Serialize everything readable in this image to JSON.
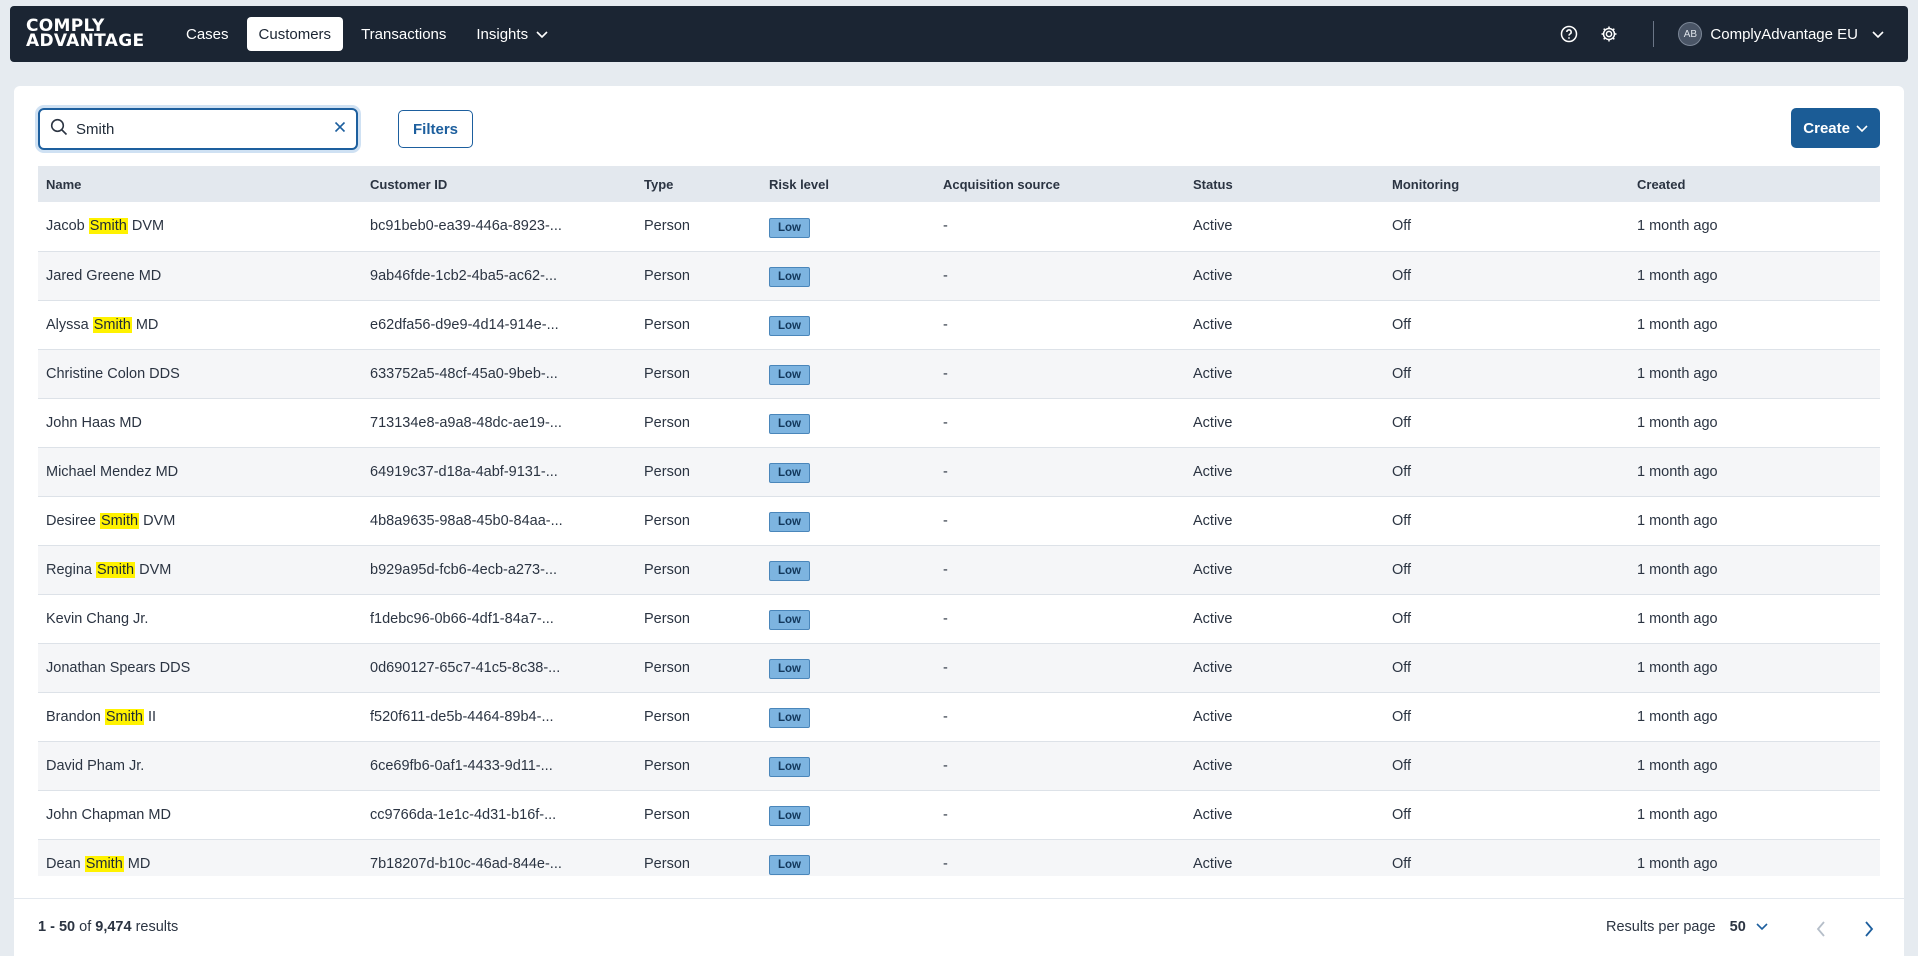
{
  "app": {
    "logo_line1": "COMPLY",
    "logo_line2": "ADVANTAGE",
    "nav": [
      {
        "label": "Cases"
      },
      {
        "label": "Customers"
      },
      {
        "label": "Transactions"
      },
      {
        "label": "Insights"
      }
    ],
    "account_initials": "AB",
    "account_name": "ComplyAdvantage EU"
  },
  "toolbar": {
    "search_value": "Smith",
    "filters_label": "Filters",
    "create_label": "Create"
  },
  "table": {
    "headers": [
      "Name",
      "Customer ID",
      "Type",
      "Risk level",
      "Acquisition source",
      "Status",
      "Monitoring",
      "Created"
    ],
    "highlight": "Smith",
    "rows": [
      {
        "name": "Jacob Smith DVM",
        "id": "bc91beb0-ea39-446a-8923-...",
        "type": "Person",
        "risk": "Low",
        "source": "-",
        "status": "Active",
        "monitoring": "Off",
        "created": "1 month ago"
      },
      {
        "name": "Jared Greene MD",
        "id": "9ab46fde-1cb2-4ba5-ac62-...",
        "type": "Person",
        "risk": "Low",
        "source": "-",
        "status": "Active",
        "monitoring": "Off",
        "created": "1 month ago"
      },
      {
        "name": "Alyssa Smith MD",
        "id": "e62dfa56-d9e9-4d14-914e-...",
        "type": "Person",
        "risk": "Low",
        "source": "-",
        "status": "Active",
        "monitoring": "Off",
        "created": "1 month ago"
      },
      {
        "name": "Christine Colon DDS",
        "id": "633752a5-48cf-45a0-9beb-...",
        "type": "Person",
        "risk": "Low",
        "source": "-",
        "status": "Active",
        "monitoring": "Off",
        "created": "1 month ago"
      },
      {
        "name": "John Haas MD",
        "id": "713134e8-a9a8-48dc-ae19-...",
        "type": "Person",
        "risk": "Low",
        "source": "-",
        "status": "Active",
        "monitoring": "Off",
        "created": "1 month ago"
      },
      {
        "name": "Michael Mendez MD",
        "id": "64919c37-d18a-4abf-9131-...",
        "type": "Person",
        "risk": "Low",
        "source": "-",
        "status": "Active",
        "monitoring": "Off",
        "created": "1 month ago"
      },
      {
        "name": "Desiree Smith DVM",
        "id": "4b8a9635-98a8-45b0-84aa-...",
        "type": "Person",
        "risk": "Low",
        "source": "-",
        "status": "Active",
        "monitoring": "Off",
        "created": "1 month ago"
      },
      {
        "name": "Regina Smith DVM",
        "id": "b929a95d-fcb6-4ecb-a273-...",
        "type": "Person",
        "risk": "Low",
        "source": "-",
        "status": "Active",
        "monitoring": "Off",
        "created": "1 month ago"
      },
      {
        "name": "Kevin Chang Jr.",
        "id": "f1debc96-0b66-4df1-84a7-...",
        "type": "Person",
        "risk": "Low",
        "source": "-",
        "status": "Active",
        "monitoring": "Off",
        "created": "1 month ago"
      },
      {
        "name": "Jonathan Spears DDS",
        "id": "0d690127-65c7-41c5-8c38-...",
        "type": "Person",
        "risk": "Low",
        "source": "-",
        "status": "Active",
        "monitoring": "Off",
        "created": "1 month ago"
      },
      {
        "name": "Brandon Smith II",
        "id": "f520f611-de5b-4464-89b4-...",
        "type": "Person",
        "risk": "Low",
        "source": "-",
        "status": "Active",
        "monitoring": "Off",
        "created": "1 month ago"
      },
      {
        "name": "David Pham Jr.",
        "id": "6ce69fb6-0af1-4433-9d11-...",
        "type": "Person",
        "risk": "Low",
        "source": "-",
        "status": "Active",
        "monitoring": "Off",
        "created": "1 month ago"
      },
      {
        "name": "John Chapman MD",
        "id": "cc9766da-1e1c-4d31-b16f-...",
        "type": "Person",
        "risk": "Low",
        "source": "-",
        "status": "Active",
        "monitoring": "Off",
        "created": "1 month ago"
      },
      {
        "name": "Dean Smith MD",
        "id": "7b18207d-b10c-46ad-844e-...",
        "type": "Person",
        "risk": "Low",
        "source": "-",
        "status": "Active",
        "monitoring": "Off",
        "created": "1 month ago"
      }
    ]
  },
  "footer": {
    "range": "1 - 50",
    "of_text": "of",
    "total": "9,474",
    "results_word": "results",
    "per_page_label": "Results per page",
    "per_page_value": "50"
  },
  "colors": {
    "nav_bg": "#1b2533",
    "accent": "#1b5c96",
    "highlight": "#fff200",
    "risk_low": "#7db4e0"
  }
}
